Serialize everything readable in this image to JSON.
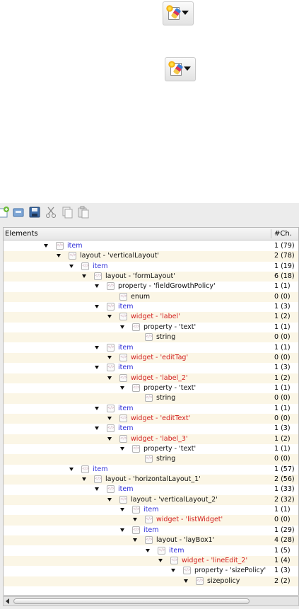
{
  "tool_buttons": [
    {
      "icon": "palette-brush-icon",
      "has_dropdown": true
    },
    {
      "icon": "palette-brush-icon",
      "has_dropdown": true
    }
  ],
  "toolbar": {
    "buttons": [
      "new-node-icon",
      "open-icon",
      "save-icon",
      "cut-icon",
      "copy-icon",
      "paste-icon"
    ]
  },
  "tree": {
    "header": {
      "elements": "Elements",
      "children": "#Ch."
    },
    "rows": [
      {
        "depth": 0,
        "kind": "item",
        "text": "item",
        "count": "1 (79)"
      },
      {
        "depth": 1,
        "kind": "layout",
        "text": "layout -  'verticalLayout'",
        "count": "2 (78)"
      },
      {
        "depth": 2,
        "kind": "item",
        "text": "item",
        "count": "1 (19)"
      },
      {
        "depth": 3,
        "kind": "layout",
        "text": "layout -  'formLayout'",
        "count": "6 (18)"
      },
      {
        "depth": 4,
        "kind": "property",
        "text": "property -  'fieldGrowthPolicy'",
        "count": "1 (1)"
      },
      {
        "depth": 5,
        "kind": "leaf",
        "text": "enum",
        "count": "0 (0)"
      },
      {
        "depth": 4,
        "kind": "item",
        "text": "item",
        "count": "1 (3)"
      },
      {
        "depth": 5,
        "kind": "widget",
        "text": "widget -  'label'",
        "count": "1 (2)"
      },
      {
        "depth": 6,
        "kind": "property",
        "text": "property -  'text'",
        "count": "1 (1)"
      },
      {
        "depth": 7,
        "kind": "leaf",
        "text": "string",
        "count": "0 (0)"
      },
      {
        "depth": 4,
        "kind": "item",
        "text": "item",
        "count": "1 (1)"
      },
      {
        "depth": 5,
        "kind": "widget",
        "text": "widget -  'editTag'",
        "count": "0 (0)"
      },
      {
        "depth": 4,
        "kind": "item",
        "text": "item",
        "count": "1 (3)"
      },
      {
        "depth": 5,
        "kind": "widget",
        "text": "widget -  'label_2'",
        "count": "1 (2)"
      },
      {
        "depth": 6,
        "kind": "property",
        "text": "property -  'text'",
        "count": "1 (1)"
      },
      {
        "depth": 7,
        "kind": "leaf",
        "text": "string",
        "count": "0 (0)"
      },
      {
        "depth": 4,
        "kind": "item",
        "text": "item",
        "count": "1 (1)"
      },
      {
        "depth": 5,
        "kind": "widget",
        "text": "widget -  'editText'",
        "count": "0 (0)"
      },
      {
        "depth": 4,
        "kind": "item",
        "text": "item",
        "count": "1 (3)"
      },
      {
        "depth": 5,
        "kind": "widget",
        "text": "widget -  'label_3'",
        "count": "1 (2)"
      },
      {
        "depth": 6,
        "kind": "property",
        "text": "property -  'text'",
        "count": "1 (1)"
      },
      {
        "depth": 7,
        "kind": "leaf",
        "text": "string",
        "count": "0 (0)"
      },
      {
        "depth": 2,
        "kind": "item",
        "text": "item",
        "count": "1 (57)"
      },
      {
        "depth": 3,
        "kind": "layout",
        "text": "layout -  'horizontalLayout_1'",
        "count": "2 (56)"
      },
      {
        "depth": 4,
        "kind": "item",
        "text": "item",
        "count": "1 (33)"
      },
      {
        "depth": 5,
        "kind": "layout",
        "text": "layout -  'verticalLayout_2'",
        "count": "2 (32)"
      },
      {
        "depth": 6,
        "kind": "item",
        "text": "item",
        "count": "1 (1)"
      },
      {
        "depth": 7,
        "kind": "widget",
        "text": "widget -  'listWidget'",
        "count": "0 (0)"
      },
      {
        "depth": 6,
        "kind": "item",
        "text": "item",
        "count": "1 (29)"
      },
      {
        "depth": 7,
        "kind": "layout",
        "text": "layout -  'layBox1'",
        "count": "4 (28)"
      },
      {
        "depth": 8,
        "kind": "item",
        "text": "item",
        "count": "1 (5)"
      },
      {
        "depth": 9,
        "kind": "widget",
        "text": "widget -  'lineEdit_2'",
        "count": "1 (4)"
      },
      {
        "depth": 10,
        "kind": "property",
        "text": "property -  'sizePolicy'",
        "count": "1 (3)"
      },
      {
        "depth": 11,
        "kind": "property",
        "text": "sizepolicy",
        "count": "2 (2)"
      }
    ]
  }
}
